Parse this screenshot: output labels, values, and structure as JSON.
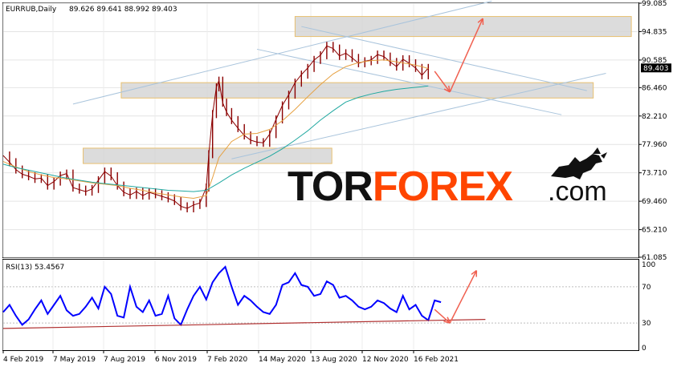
{
  "chart_data": [
    {
      "type": "line",
      "header": {
        "symbol": "EURRUB,Daily",
        "ohlc": "89.626 89.641 88.992 89.403"
      },
      "last_price_label": "89.403",
      "last_price": 89.403,
      "ylim": [
        61.085,
        99.085
      ],
      "y_ticks": [
        "99.085",
        "94.835",
        "90.585",
        "86.460",
        "82.210",
        "77.960",
        "73.710",
        "69.460",
        "65.210",
        "61.085"
      ],
      "y_tick_values": [
        99.085,
        94.835,
        90.585,
        86.46,
        82.21,
        77.96,
        73.71,
        69.46,
        65.21,
        61.085
      ],
      "x_ticks": [
        "4 Feb 2019",
        "7 May 2019",
        "7 Aug 2019",
        "6 Nov 2019",
        "7 Feb 2020",
        "14 May 2020",
        "13 Aug 2020",
        "12 Nov 2020",
        "16 Feb 2021"
      ],
      "series": [
        {
          "color": "#8b0000",
          "style": "candles",
          "points": [
            [
              0,
              76.3
            ],
            [
              0.5,
              75.3
            ],
            [
              1,
              74.2
            ],
            [
              1.5,
              73.5
            ],
            [
              2,
              73.2
            ],
            [
              2.5,
              72.8
            ],
            [
              3,
              72.9
            ],
            [
              3.5,
              71.8
            ],
            [
              4,
              72.4
            ],
            [
              4.5,
              73.3
            ],
            [
              5,
              73.6
            ],
            [
              5.5,
              71.5
            ],
            [
              6,
              71.2
            ],
            [
              6.5,
              70.9
            ],
            [
              7,
              71.3
            ],
            [
              7.5,
              72.6
            ],
            [
              8,
              73.9
            ],
            [
              8.5,
              73.2
            ],
            [
              9,
              71.8
            ],
            [
              9.5,
              70.8
            ],
            [
              10,
              70.4
            ],
            [
              10.5,
              70.9
            ],
            [
              11,
              70.3
            ],
            [
              11.5,
              70.8
            ],
            [
              12,
              70.5
            ],
            [
              12.5,
              70.2
            ],
            [
              13,
              69.9
            ],
            [
              13.5,
              69.5
            ],
            [
              14,
              68.7
            ],
            [
              14.5,
              68.4
            ],
            [
              15,
              68.9
            ],
            [
              15.5,
              69.2
            ],
            [
              16,
              71.5
            ],
            [
              16.2,
              76.5
            ],
            [
              16.5,
              82.5
            ],
            [
              16.8,
              86.5
            ],
            [
              17,
              87.5
            ],
            [
              17.3,
              84.2
            ],
            [
              17.6,
              82.8
            ],
            [
              18,
              81.6
            ],
            [
              18.5,
              80.4
            ],
            [
              19,
              79.3
            ],
            [
              19.5,
              78.6
            ],
            [
              20,
              78.3
            ],
            [
              20.5,
              78.2
            ],
            [
              21,
              79.5
            ],
            [
              21.5,
              81.7
            ],
            [
              22,
              83.8
            ],
            [
              22.5,
              85.4
            ],
            [
              23,
              87.2
            ],
            [
              23.5,
              88.4
            ],
            [
              24,
              89.4
            ],
            [
              24.5,
              90.6
            ],
            [
              25,
              91.3
            ],
            [
              25.5,
              92.7
            ],
            [
              26,
              92.3
            ],
            [
              26.5,
              91.2
            ],
            [
              27,
              91.6
            ],
            [
              27.5,
              90.9
            ],
            [
              28,
              90.1
            ],
            [
              28.5,
              90.4
            ],
            [
              29,
              90.6
            ],
            [
              29.5,
              91.4
            ],
            [
              30,
              91.1
            ],
            [
              30.5,
              90.3
            ],
            [
              31,
              89.6
            ],
            [
              31.5,
              90.7
            ],
            [
              32,
              90.1
            ],
            [
              32.5,
              89.4
            ],
            [
              33,
              88.3
            ],
            [
              33.5,
              89.4
            ]
          ]
        },
        {
          "color": "#e6a040",
          "style": "moving-average",
          "points": [
            [
              0,
              75.4
            ],
            [
              1,
              74.6
            ],
            [
              2,
              73.9
            ],
            [
              3,
              73.4
            ],
            [
              4,
              73
            ],
            [
              5,
              72.8
            ],
            [
              6,
              72.5
            ],
            [
              7,
              72.2
            ],
            [
              8,
              72
            ],
            [
              9,
              71.8
            ],
            [
              10,
              71.4
            ],
            [
              11,
              71.1
            ],
            [
              12,
              70.7
            ],
            [
              13,
              70.4
            ],
            [
              14,
              70.1
            ],
            [
              15,
              69.9
            ],
            [
              16,
              70.3
            ],
            [
              16.5,
              73
            ],
            [
              17,
              76
            ],
            [
              18,
              78.4
            ],
            [
              19,
              79.5
            ],
            [
              20,
              79.6
            ],
            [
              21,
              80.2
            ],
            [
              22,
              81.5
            ],
            [
              23,
              83.2
            ],
            [
              24,
              85.1
            ],
            [
              25,
              86.9
            ],
            [
              26,
              88.5
            ],
            [
              27,
              89.6
            ],
            [
              28,
              90.2
            ],
            [
              29,
              90.5
            ],
            [
              30,
              90.6
            ],
            [
              31,
              90.3
            ],
            [
              32,
              90
            ],
            [
              33,
              89.6
            ],
            [
              33.5,
              89.3
            ]
          ]
        },
        {
          "color": "#20a8a0",
          "style": "moving-average",
          "points": [
            [
              0,
              75
            ],
            [
              1,
              74.5
            ],
            [
              2,
              74.1
            ],
            [
              3,
              73.7
            ],
            [
              4,
              73.3
            ],
            [
              5,
              72.9
            ],
            [
              6,
              72.6
            ],
            [
              7,
              72.3
            ],
            [
              8,
              72.1
            ],
            [
              9,
              71.9
            ],
            [
              10,
              71.7
            ],
            [
              11,
              71.5
            ],
            [
              12,
              71.3
            ],
            [
              13,
              71.1
            ],
            [
              14,
              71
            ],
            [
              15,
              70.9
            ],
            [
              16,
              71.1
            ],
            [
              17,
              72.2
            ],
            [
              18,
              73.4
            ],
            [
              19,
              74.4
            ],
            [
              20,
              75.3
            ],
            [
              21,
              76.2
            ],
            [
              22,
              77.3
            ],
            [
              23,
              78.6
            ],
            [
              24,
              80
            ],
            [
              25,
              81.6
            ],
            [
              26,
              83
            ],
            [
              27,
              84.3
            ],
            [
              28,
              85
            ],
            [
              29,
              85.5
            ],
            [
              30,
              85.9
            ],
            [
              31,
              86.2
            ],
            [
              32,
              86.4
            ],
            [
              33,
              86.6
            ],
            [
              33.5,
              86.7
            ]
          ]
        }
      ],
      "channel_lines": [
        {
          "from": [
            5.5,
            84.0
          ],
          "to": [
            38.5,
            99.4
          ]
        },
        {
          "from": [
            20,
            92.2
          ],
          "to": [
            44,
            82.4
          ]
        },
        {
          "from": [
            23.5,
            95.6
          ],
          "to": [
            46,
            86.0
          ]
        },
        {
          "from": [
            18,
            75.8
          ],
          "to": [
            47.5,
            88.6
          ]
        }
      ],
      "zones": [
        {
          "from_x": 23,
          "to_x": 49.5,
          "ylow": 94.1,
          "yhigh": 97.1
        },
        {
          "from_x": 9.3,
          "to_x": 46.5,
          "ylow": 84.9,
          "yhigh": 87.2
        },
        {
          "from_x": 6.3,
          "to_x": 25.9,
          "ylow": 75.1,
          "yhigh": 77.4
        }
      ],
      "forecast_arrows": [
        {
          "from": [
            34,
            88.9
          ],
          "to": [
            35.2,
            85.8
          ],
          "color": "#f06050"
        },
        {
          "from": [
            35.2,
            85.8
          ],
          "to": [
            37.8,
            96.8
          ],
          "color": "#f06050"
        }
      ]
    },
    {
      "type": "line",
      "header": {
        "label": "RSI(13) 53.4567"
      },
      "ylim": [
        0,
        100
      ],
      "y_ticks": [
        "100",
        "70",
        "30",
        "0"
      ],
      "y_tick_values": [
        100,
        70,
        30,
        0
      ],
      "x_ticks": [
        "4 Feb 2019",
        "7 May 2019",
        "7 Aug 2019",
        "6 Nov 2019",
        "7 Feb 2020",
        "14 May 2020",
        "13 Aug 2020",
        "12 Nov 2020",
        "16 Feb 2021"
      ],
      "series": [
        {
          "color": "#0000ff",
          "points": [
            [
              0,
              42
            ],
            [
              0.5,
              50
            ],
            [
              1,
              38
            ],
            [
              1.5,
              28
            ],
            [
              2,
              34
            ],
            [
              2.5,
              45
            ],
            [
              3,
              55
            ],
            [
              3.5,
              40
            ],
            [
              4,
              50
            ],
            [
              4.5,
              60
            ],
            [
              5,
              44
            ],
            [
              5.5,
              38
            ],
            [
              6,
              40
            ],
            [
              6.5,
              48
            ],
            [
              7,
              58
            ],
            [
              7.5,
              46
            ],
            [
              8,
              70
            ],
            [
              8.5,
              62
            ],
            [
              9,
              38
            ],
            [
              9.5,
              36
            ],
            [
              10,
              70
            ],
            [
              10.5,
              48
            ],
            [
              11,
              42
            ],
            [
              11.5,
              55
            ],
            [
              12,
              38
            ],
            [
              12.5,
              40
            ],
            [
              13,
              60
            ],
            [
              13.5,
              35
            ],
            [
              14,
              28
            ],
            [
              14.5,
              45
            ],
            [
              15,
              60
            ],
            [
              15.5,
              70
            ],
            [
              16,
              56
            ],
            [
              16.5,
              75
            ],
            [
              17,
              85
            ],
            [
              17.5,
              92
            ],
            [
              18,
              70
            ],
            [
              18.5,
              50
            ],
            [
              19,
              60
            ],
            [
              19.5,
              55
            ],
            [
              20,
              48
            ],
            [
              20.5,
              42
            ],
            [
              21,
              40
            ],
            [
              21.5,
              50
            ],
            [
              22,
              72
            ],
            [
              22.5,
              75
            ],
            [
              23,
              85
            ],
            [
              23.5,
              72
            ],
            [
              24,
              70
            ],
            [
              24.5,
              60
            ],
            [
              25,
              62
            ],
            [
              25.5,
              76
            ],
            [
              26,
              72
            ],
            [
              26.5,
              58
            ],
            [
              27,
              60
            ],
            [
              27.5,
              55
            ],
            [
              28,
              48
            ],
            [
              28.5,
              45
            ],
            [
              29,
              48
            ],
            [
              29.5,
              55
            ],
            [
              30,
              52
            ],
            [
              30.5,
              46
            ],
            [
              31,
              42
            ],
            [
              31.5,
              60
            ],
            [
              32,
              45
            ],
            [
              32.5,
              50
            ],
            [
              33,
              38
            ],
            [
              33.5,
              33
            ],
            [
              34,
              55
            ],
            [
              34.5,
              53
            ]
          ]
        },
        {
          "color": "#b03030",
          "points": [
            [
              0,
              24
            ],
            [
              38,
              34
            ]
          ]
        }
      ],
      "forecast_arrows": [
        {
          "from": [
            34,
            45
          ],
          "to": [
            35.2,
            30
          ],
          "color": "#f06050"
        },
        {
          "from": [
            35.2,
            30
          ],
          "to": [
            37.3,
            88
          ],
          "color": "#f06050"
        }
      ]
    }
  ],
  "logo": {
    "brand_main": "TOR",
    "brand_accent": "FOREX",
    "brand_tail": ".com",
    "main_color": "#111111",
    "accent_color": "#ff4500"
  }
}
